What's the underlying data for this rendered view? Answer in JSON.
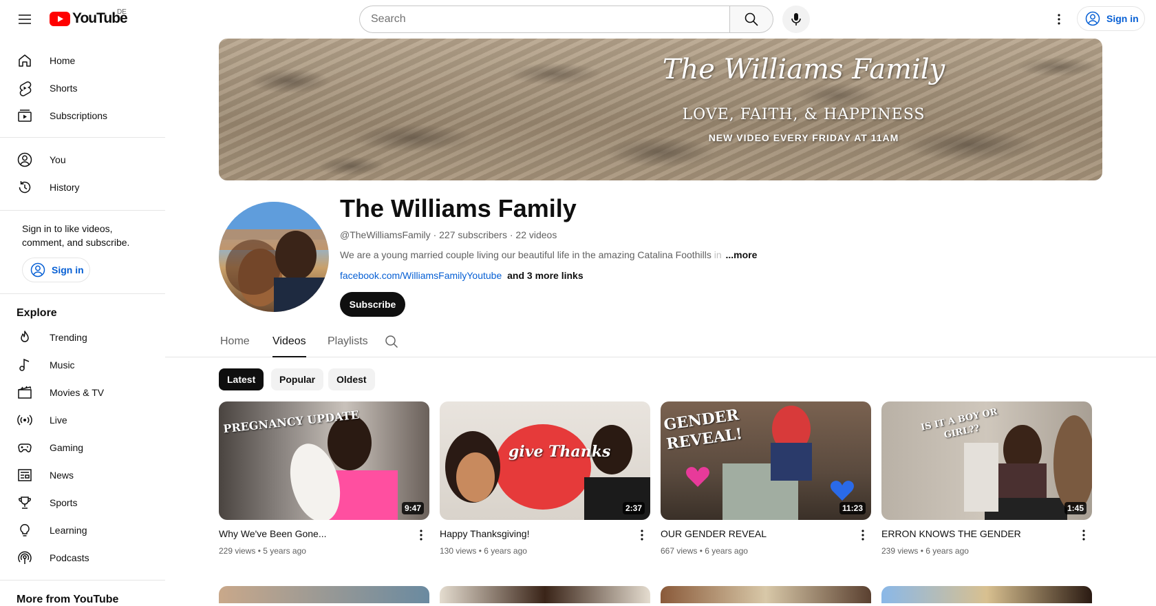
{
  "topbar": {
    "logo_text": "YouTube",
    "country_code": "DE",
    "search_placeholder": "Search",
    "signin_label": "Sign in"
  },
  "sidebar": {
    "section1": [
      {
        "label": "Home",
        "icon": "home-icon"
      },
      {
        "label": "Shorts",
        "icon": "shorts-icon"
      },
      {
        "label": "Subscriptions",
        "icon": "subscriptions-icon"
      }
    ],
    "section2": [
      {
        "label": "You",
        "icon": "user-icon"
      },
      {
        "label": "History",
        "icon": "history-icon"
      }
    ],
    "signin_prompt": "Sign in to like videos, comment, and subscribe.",
    "signin_label": "Sign in",
    "explore_heading": "Explore",
    "explore": [
      {
        "label": "Trending",
        "icon": "trending-icon"
      },
      {
        "label": "Music",
        "icon": "music-icon"
      },
      {
        "label": "Movies & TV",
        "icon": "movies-icon"
      },
      {
        "label": "Live",
        "icon": "live-icon"
      },
      {
        "label": "Gaming",
        "icon": "gaming-icon"
      },
      {
        "label": "News",
        "icon": "news-icon"
      },
      {
        "label": "Sports",
        "icon": "sports-icon"
      },
      {
        "label": "Learning",
        "icon": "learning-icon"
      },
      {
        "label": "Podcasts",
        "icon": "podcasts-icon"
      }
    ],
    "more_heading": "More from YouTube"
  },
  "banner": {
    "title": "The Williams Family",
    "subtitle": "LOVE, FAITH, & HAPPINESS",
    "tagline": "NEW VIDEO EVERY FRIDAY AT 11AM"
  },
  "channel": {
    "name": "The Williams Family",
    "handle": "@TheWilliamsFamily",
    "subscribers": "227 subscribers",
    "videos_count": "22 videos",
    "description": "We are a young married couple living our beautiful life in the amazing Catalina Foothills",
    "description_fade": "in",
    "more_label": "...more",
    "link": "facebook.com/WilliamsFamilyYoutube",
    "more_links": "and 3 more links",
    "subscribe_label": "Subscribe"
  },
  "tabs": [
    {
      "label": "Home",
      "active": false
    },
    {
      "label": "Videos",
      "active": true
    },
    {
      "label": "Playlists",
      "active": false
    }
  ],
  "chips": [
    {
      "label": "Latest",
      "active": true
    },
    {
      "label": "Popular",
      "active": false
    },
    {
      "label": "Oldest",
      "active": false
    }
  ],
  "videos": [
    {
      "title": "Why We've Been Gone...",
      "views": "229 views",
      "age": "5 years ago",
      "duration": "9:47",
      "overlay": "PREGNANCY UPDATE"
    },
    {
      "title": "Happy Thanksgiving!",
      "views": "130 views",
      "age": "6 years ago",
      "duration": "2:37",
      "overlay": "give Thanks"
    },
    {
      "title": "OUR GENDER REVEAL",
      "views": "667 views",
      "age": "6 years ago",
      "duration": "11:23",
      "overlay": "GENDER REVEAL!"
    },
    {
      "title": "ERRON KNOWS THE GENDER",
      "views": "239 views",
      "age": "6 years ago",
      "duration": "1:45",
      "overlay": "IS IT A BOY OR GIRL??"
    }
  ]
}
